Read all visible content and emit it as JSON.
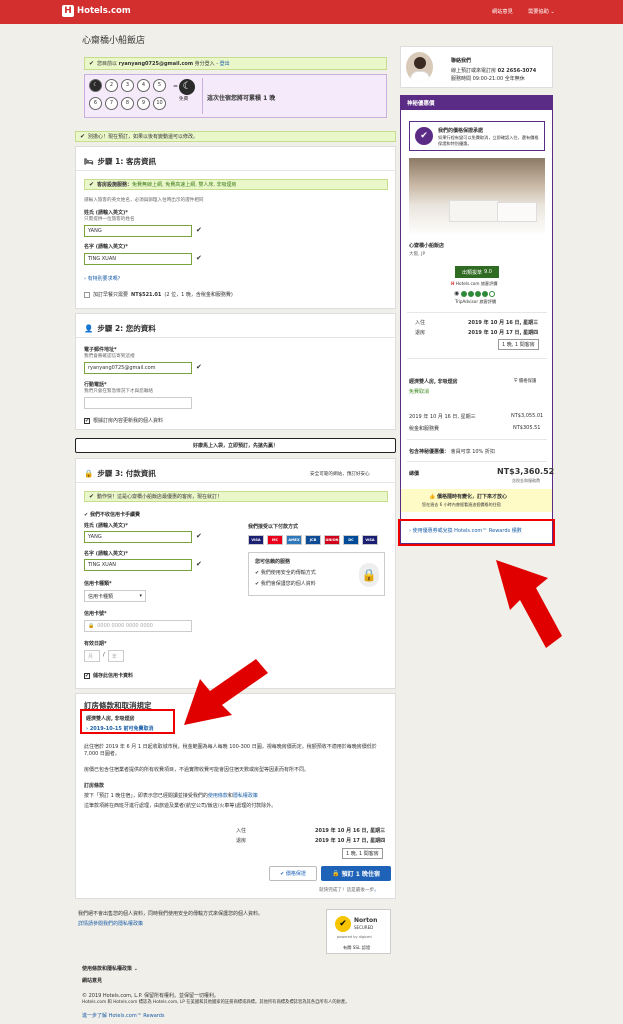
{
  "header": {
    "brand": "Hotels.com",
    "brand_mark": "H",
    "nav_feedback": "網站意見",
    "nav_help": "需要協助",
    "nav_help_caret": "⌄"
  },
  "page_title": "心齋橋小船飯店",
  "login_bar": {
    "prefix": "您目前以",
    "email": "ryanyang0725@gmail.com",
    "suffix": "身分登入 -",
    "logout": "登出"
  },
  "stamps": {
    "numbers": [
      "1",
      "2",
      "3",
      "4",
      "5",
      "6",
      "7",
      "8",
      "9",
      "10"
    ],
    "free_label": "免費",
    "message": "這次住宿您將可累積 1 晚"
  },
  "notice_bar": "別擔心！現在預訂，如果以後有變動還可以修改。",
  "step1": {
    "title": "步驟 1: 客房資訊",
    "amenity_label": "客房設施服務：",
    "amenity_text": "免費無線上網, 免費高速上網, 雙人床, 非吸煙房",
    "name_note": "請輸入旅客的英文姓名，必須與辦理入住時出示的證件相同",
    "surname_label": "姓氏 (請輸入英文)*",
    "surname_sub": "只需提供一位旅客的姓名",
    "surname_value": "YANG",
    "given_label": "名字 (請輸入英文)*",
    "given_value": "TING XUAN",
    "special_link": "有特別要求嗎？",
    "breakfast_prefix": "加訂早餐只需要",
    "breakfast_price": "NT$521.01",
    "breakfast_suffix": "(2 位，1 晚，含稅金和服務費)"
  },
  "step2": {
    "title": "步驟 2: 您的資料",
    "email_label": "電子郵件地址*",
    "email_sub": "我們會將確認信寄到這裡",
    "email_value": "ryanyang0725@gmail.com",
    "phone_label": "行動電話*",
    "phone_sub": "我們只會在緊急情況下才與您聯絡",
    "update_label": "根據訂房內容更新我的個人資料"
  },
  "promo_banner": "好康馬上入袋，立即預訂，先搶先贏！",
  "step3": {
    "title": "步驟 3: 付款資訊",
    "secure_text": "安全可靠的網站，預訂好安心",
    "promo_text": "動作快！這是心齋橋小船飯店最優惠的客房，現在就訂！",
    "no_fee_label": "我們不收信用卡手續費",
    "surname_label": "姓氏 (請輸入英文)*",
    "surname_value": "YANG",
    "given_label": "名字 (請輸入英文)*",
    "given_value": "TING XUAN",
    "card_type_label": "信用卡種類*",
    "card_type_value": "信用卡種類",
    "card_number_label": "信用卡號*",
    "card_number_placeholder": "0000 0000 0000 0000",
    "expiry_label": "有效日期*",
    "expiry_month": "月",
    "expiry_year": "年",
    "expiry_sep": "/",
    "save_card_label": "儲存此信用卡資料",
    "accepted_title": "我們接受以下付款方式",
    "cards": [
      "VISA",
      "MC",
      "AMEX",
      "JCB",
      "UNION",
      "DC",
      "VISA"
    ],
    "protect_title": "您可信賴的服務",
    "protect_1": "我們使用安全的傳輸方式",
    "protect_2": "我們會保護您的個人資料"
  },
  "terms": {
    "title": "訂房條款和取消規定",
    "room_name": "經濟雙人房, 非吸煙房",
    "cancel_link": "2019-10-15 前可免費取消",
    "p1": "此住宿於 2019 年 6 月 1 日起收取城市稅，稅金範圍為每人每晚 100-300 日圓，視每晚房價而定。稅額預收不適用於每晚房價低於 7,000 日圓者。",
    "p2": "房價已包含住宿業者提供的所有收費項目，不過實際收費可能會因住宿天數或房型等因素而有所不同。",
    "rules_title": "訂房條款",
    "p3_prefix": "按下「預訂 1 晚住宿」，即表示您已經閱讀並接受我們的",
    "p3_link1": "使用條款",
    "p3_mid": "和",
    "p3_link2": "隱私權政策",
    "p4": "這筆款項將在西班牙進行處理，由旅遊及業者(航空公司/飯店/火車等)處理的付款除外。",
    "checkin_label": "入住",
    "checkin_date": "2019 年 10 月 16 日, 星期三",
    "checkout_label": "退房",
    "checkout_date": "2019 年 10 月 17 日, 星期四",
    "stay_summary": "1 晚, 1 間客房",
    "btn_insure": "價格保證",
    "btn_book": "預訂 1 晚住宿",
    "btn_book_icon": "🔒",
    "sub_prefix": "就快完成了！這是最後一步",
    "sub_suffix": "。"
  },
  "footer_notes": {
    "line1": "我們絕不會出售您的個人資料，同時我們使用安全的傳輸方式來保護您的個人資料。",
    "line2": "詳情請參閱我們的隱私權政策",
    "norton_brand": "Norton",
    "norton_sub": "SECURED",
    "norton_by": "powered by digicert",
    "norton_caption": "有關 SSL 認證",
    "links_terms": "使用條款和隱私權政策",
    "links_feedback": "網站意見",
    "copyright1": "© 2019 Hotels.com, L.P. 保留所有權利。並保留一切權利。",
    "copyright2": "Hotels.com 和 Hotels.com 標誌為 Hotels.com, LP 在美國和其他國家的註冊商標或商標。其他所有商標及標誌皆為其各自所有人的財產。",
    "rewards_link": "進一步了解 Hotels.com™ Rewards"
  },
  "contact": {
    "title": "聯絡我們",
    "line1_prefix": "線上預訂或來電訂房",
    "phone": "02 2656-3074",
    "line2": "服務時間 09:00-21:00 全年無休"
  },
  "sidebar": {
    "header": "神秘優惠價",
    "guarantee_title": "我們的價格保證承諾",
    "guarantee_text": "如果行程有變可以免費取消，立即確認入住，還有價格保證和特別優惠。",
    "hotel_name": "心齋橋小船飯店",
    "hotel_location": "大阪, JP",
    "rating_label": "出類拔萃",
    "rating_value": "9.0",
    "rating_source": "Hotels.com 旅客評價",
    "tripadvisor_label": "TripAdvisor 旅客評價",
    "checkin_label": "入住",
    "checkin_date": "2019 年 10 月 16 日, 星期三",
    "checkout_label": "退房",
    "checkout_date": "2019 年 10 月 17 日, 星期四",
    "stay_summary": "1 晚, 1 間客房",
    "room_name": "經濟雙人房, 非吸煙房",
    "room_side": "價格保護",
    "free_cancel": "免費取消",
    "date_line": "2019 年 10 月 16 日, 星期三",
    "date_price": "NT$3,055.01",
    "tax_label": "稅金和服務費",
    "tax_price": "NT$305.51",
    "member_label": "包含神秘優惠價：",
    "member_text": "會員可享 10% 折扣",
    "total_label": "總價",
    "total_price": "NT$3,360.52",
    "total_sub": "含稅金和服務費",
    "price_change_title": "價格隨時有變化，訂下來才放心",
    "price_change_sub": "您在過去 6 小時內曾經看過這個價格的住宿",
    "rewards_link": "使用優惠券或兌換 Hotels.com™ Rewards 積數"
  },
  "colors": {
    "brand_red": "#d32f2f",
    "promo_purple": "#5a2c85",
    "link_blue": "#1a5ea8",
    "highlight_green": "#eaf7c9",
    "annotation_red": "#e00000"
  }
}
